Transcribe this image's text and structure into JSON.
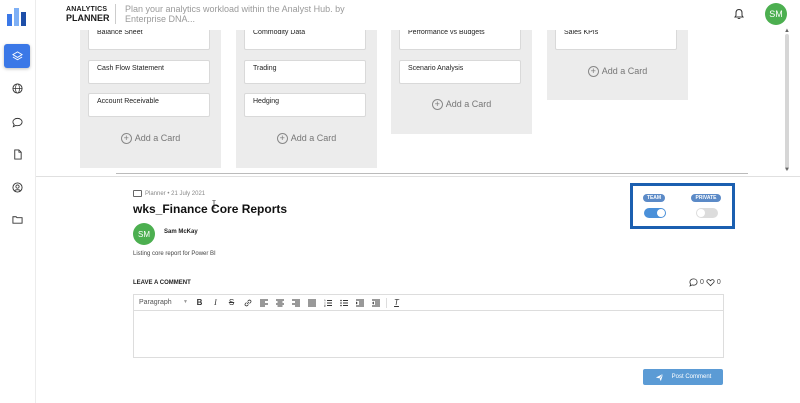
{
  "app": {
    "brand_line1": "ANALYTICS",
    "brand_line2": "PLANNER",
    "tagline": "Plan your analytics workload within the Analyst Hub. by Enterprise DNA...",
    "user_initials": "SM",
    "accent": "#3b78e7",
    "avatar_color": "#4caf50"
  },
  "sidebar": {
    "items": [
      {
        "icon": "layers-icon",
        "active": true
      },
      {
        "icon": "globe-icon",
        "active": false
      },
      {
        "icon": "chat-icon",
        "active": false
      },
      {
        "icon": "document-icon",
        "active": false
      },
      {
        "icon": "user-circle-icon",
        "active": false
      },
      {
        "icon": "folder-icon",
        "active": false
      }
    ]
  },
  "board": {
    "add_card_label": "Add a Card",
    "columns": [
      {
        "cards": [
          "Balance Sheet",
          "Cash Flow Statement",
          "Account Receivable"
        ]
      },
      {
        "cards": [
          "Commodity Data",
          "Trading",
          "Hedging"
        ]
      },
      {
        "cards": [
          "Performance vs Budgets",
          "Scenario Analysis"
        ]
      },
      {
        "cards": [
          "Sales KPIs"
        ]
      }
    ]
  },
  "detail": {
    "meta": "Planner • 21 July 2021",
    "title": "wks_Finance Core Reports",
    "owner_initials": "SM",
    "owner_name": "Sam McKay",
    "description": "Listing core report for Power BI",
    "visibility": {
      "team_label": "TEAM",
      "private_label": "PRIVATE",
      "team_on": true,
      "private_on": false
    },
    "comment_heading": "LEAVE A COMMENT",
    "comment_count": "0",
    "like_count": "0",
    "editor_format": "Paragraph",
    "post_button": "Post Comment"
  }
}
